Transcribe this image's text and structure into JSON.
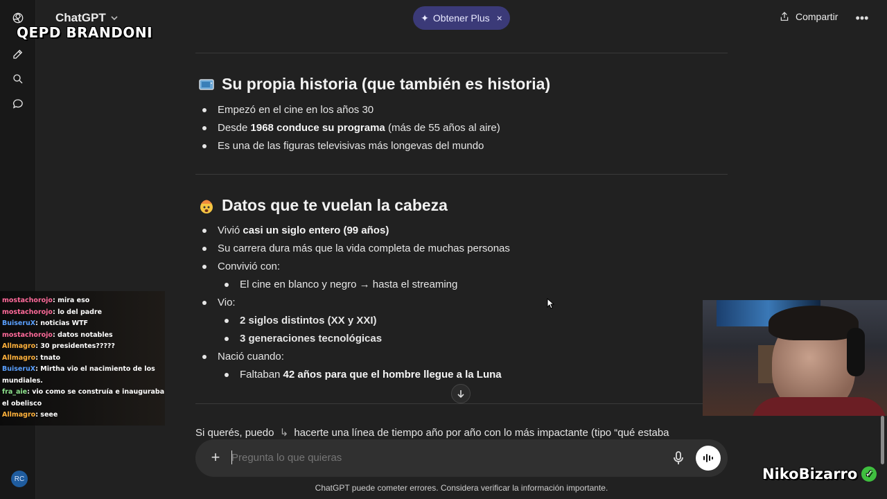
{
  "header": {
    "app_title": "ChatGPT",
    "overlay_title": "QEPD BRANDONI",
    "plus_button": "Obtener Plus",
    "share_label": "Compartir"
  },
  "sidebar": {
    "avatar_initials": "RC"
  },
  "section1": {
    "title": "Su propia historia (que también es historia)",
    "emoji": "tv-icon",
    "b1": "Empezó en el cine en los años 30",
    "b2_pre": "Desde ",
    "b2_bold": "1968 conduce su programa",
    "b2_post": " (más de 55 años al aire)",
    "b3": "Es una de las figuras televisivas más longevas del mundo"
  },
  "section2": {
    "title": "Datos que te vuelan la cabeza",
    "emoji": "exploding-head-icon",
    "b1_pre": "Vivió ",
    "b1_bold": "casi un siglo entero (99 años)",
    "b2": "Su carrera dura más que la vida completa de muchas personas",
    "b3": "Convivió con:",
    "b3_sub1": "El cine en blanco y negro → hasta el streaming",
    "b4": "Vio:",
    "b4_sub1": "2 siglos distintos (XX y XXI)",
    "b4_sub2": "3 generaciones tecnológicas",
    "b5": "Nació cuando:",
    "b5_sub1_pre": "Faltaban ",
    "b5_sub1_bold": "42 años para que el hombre llegue a la Luna"
  },
  "footer_text": {
    "pre": "Si querés, puedo",
    "post": "hacerte una línea de tiempo año por año con lo más impactante (tipo “qué estaba"
  },
  "composer": {
    "placeholder": "Pregunta lo que quieras"
  },
  "disclaimer": "ChatGPT puede cometer errores. Considera verificar la información importante.",
  "stream_chat": [
    {
      "user": "mostachorojo",
      "msg": "mira eso",
      "color": "#ff6a9a"
    },
    {
      "user": "mostachorojo",
      "msg": "lo del padre",
      "color": "#ff6a9a"
    },
    {
      "user": "BuiseruX",
      "msg": "noticias WTF",
      "color": "#5aa0ff"
    },
    {
      "user": "mostachorojo",
      "msg": "datos notables",
      "color": "#ff6a9a"
    },
    {
      "user": "Allmagro",
      "msg": "30 presidentes?????",
      "color": "#ffb13b"
    },
    {
      "user": "Allmagro",
      "msg": "tnato",
      "color": "#ffb13b"
    },
    {
      "user": "BuiseruX",
      "msg": "Mirtha vio el nacimiento de los mundiales.",
      "color": "#5aa0ff"
    },
    {
      "user": "fra_aie",
      "msg": "vio como se construía e inauguraba el obelisco",
      "color": "#8de28d"
    },
    {
      "user": "Allmagro",
      "msg": "seee",
      "color": "#ffb13b"
    }
  ],
  "streamer_name": "NikoBizarro"
}
